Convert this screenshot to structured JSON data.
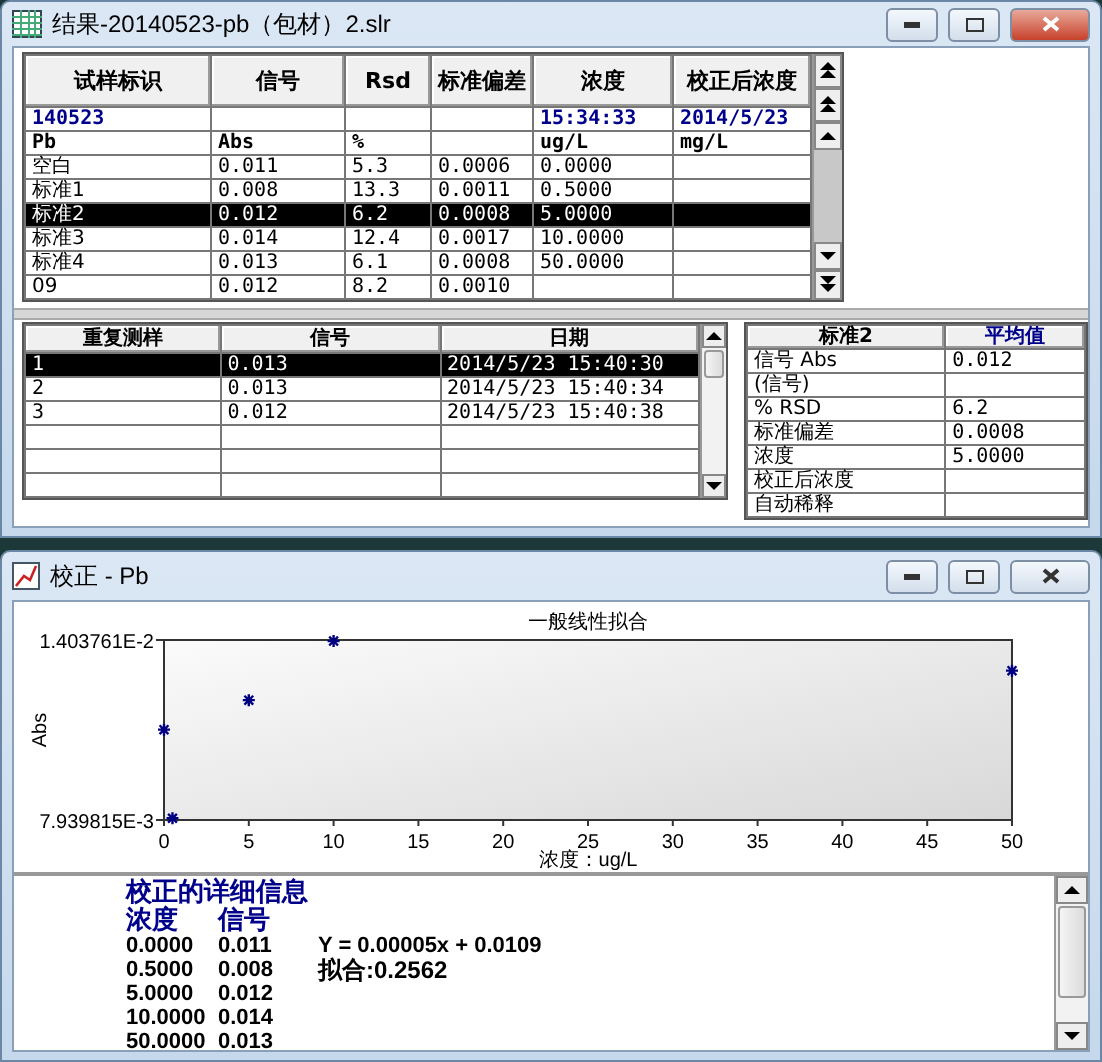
{
  "results_window": {
    "title": "结果-20140523-pb（包材）2.slr",
    "main_table": {
      "columns": [
        "试样标识",
        "信号",
        "Rsd",
        "标准偏差",
        "浓度",
        "校正后浓度"
      ],
      "info_rows": [
        {
          "sample_id": "140523",
          "concentration": "15:34:33",
          "corrected_concentration": "2014/5/23"
        },
        {
          "sample_id": "Pb",
          "signal": "Abs",
          "rsd": "%",
          "concentration": "ug/L",
          "corrected_concentration": "mg/L"
        }
      ],
      "rows": [
        {
          "sample_id": "空白",
          "signal": "0.011",
          "rsd": "5.3",
          "std_dev": "0.0006",
          "concentration": "0.0000",
          "selected": false
        },
        {
          "sample_id": "标准1",
          "signal": "0.008",
          "rsd": "13.3",
          "std_dev": "0.0011",
          "concentration": "0.5000",
          "selected": false
        },
        {
          "sample_id": "标准2",
          "signal": "0.012",
          "rsd": "6.2",
          "std_dev": "0.0008",
          "concentration": "5.0000",
          "selected": true
        },
        {
          "sample_id": "标准3",
          "signal": "0.014",
          "rsd": "12.4",
          "std_dev": "0.0017",
          "concentration": "10.0000",
          "selected": false
        },
        {
          "sample_id": "标准4",
          "signal": "0.013",
          "rsd": "6.1",
          "std_dev": "0.0008",
          "concentration": "50.0000",
          "selected": false
        },
        {
          "sample_id": "09",
          "signal": "0.012",
          "rsd": "8.2",
          "std_dev": "0.0010",
          "selected": false
        }
      ]
    },
    "replicates_table": {
      "columns": [
        "重复测样",
        "信号",
        "日期"
      ],
      "rows": [
        {
          "replicate": "1",
          "signal": "0.013",
          "date": "2014/5/23 15:40:30",
          "selected": true
        },
        {
          "replicate": "2",
          "signal": "0.013",
          "date": "2014/5/23 15:40:34",
          "selected": false
        },
        {
          "replicate": "3",
          "signal": "0.012",
          "date": "2014/5/23 15:40:38",
          "selected": false
        }
      ]
    },
    "stats_table": {
      "columns": [
        "标准2",
        "平均值"
      ],
      "rows": [
        {
          "label": "信号 Abs",
          "value": "0.012"
        },
        {
          "label": "(信号)"
        },
        {
          "label": "% RSD",
          "value": "6.2"
        },
        {
          "label": "标准偏差",
          "value": "0.0008"
        },
        {
          "label": "浓度",
          "value": "5.0000"
        },
        {
          "label": "校正后浓度"
        },
        {
          "label": "自动稀释"
        }
      ]
    }
  },
  "calibration_window": {
    "title": "校正 - Pb",
    "chart_data": {
      "type": "scatter",
      "title": "一般线性拟合",
      "xlabel": "浓度：ug/L",
      "ylabel": "Abs",
      "x": [
        0,
        0.5,
        5,
        10,
        50
      ],
      "series": [
        {
          "color": "#000080",
          "values": [
            0.011,
            0.008,
            0.012,
            0.014,
            0.013
          ]
        }
      ],
      "xlim": [
        0,
        50
      ],
      "ylim": [
        0.007939815,
        0.01403761
      ],
      "xticks": [
        0,
        5,
        10,
        15,
        20,
        25,
        30,
        35,
        40,
        45,
        50
      ],
      "yticks": [
        {
          "value": 0.007939815,
          "label": "7.939815E-3"
        },
        {
          "value": 0.01403761,
          "label": "1.403761E-2"
        }
      ]
    },
    "details": {
      "heading": "校正的详细信息",
      "columns": [
        "浓度",
        "信号"
      ],
      "rows": [
        [
          "0.0000",
          "0.011"
        ],
        [
          "0.5000",
          "0.008"
        ],
        [
          "5.0000",
          "0.012"
        ],
        [
          "10.0000",
          "0.014"
        ],
        [
          "50.0000",
          "0.013"
        ]
      ],
      "equation": "Y = 0.00005x + 0.0109",
      "fit": "拟合:0.2562"
    }
  }
}
